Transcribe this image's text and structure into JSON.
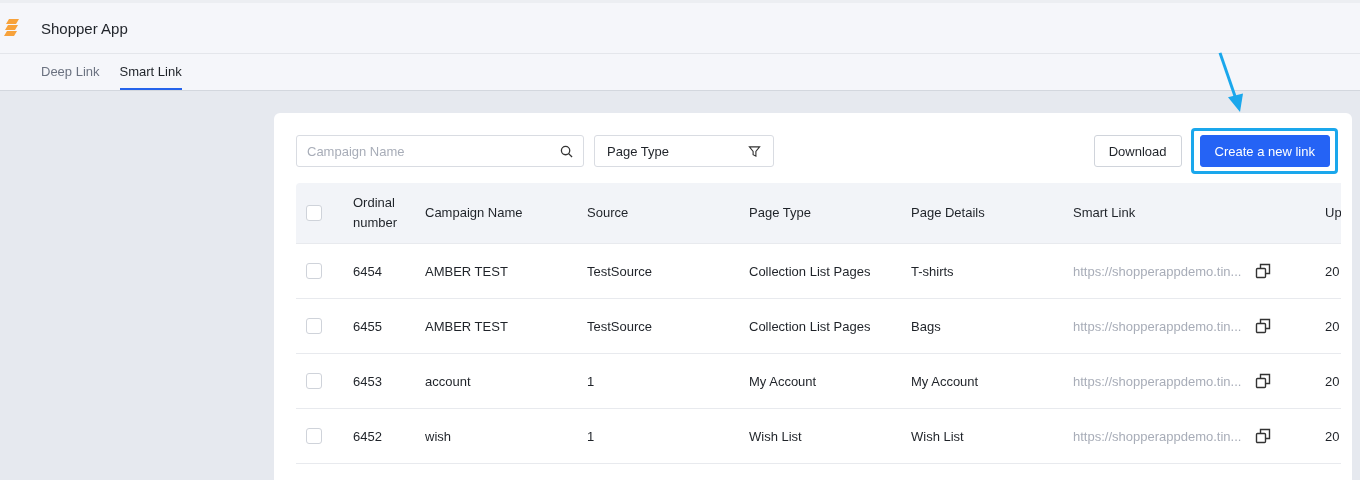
{
  "app": {
    "title": "Shopper App"
  },
  "tabs": [
    {
      "label": "Deep Link",
      "selected": false
    },
    {
      "label": "Smart Link",
      "selected": true
    }
  ],
  "filters": {
    "campaign_search": {
      "placeholder": "Campaign Name"
    },
    "page_type": {
      "value": "Page Type"
    }
  },
  "actions": {
    "download": "Download",
    "create": "Create a new link"
  },
  "table": {
    "header_checked": false,
    "columns": [
      "Ordinal\nnumber",
      "Campaign Name",
      "Source",
      "Page Type",
      "Page Details",
      "Smart Link",
      "Up"
    ],
    "rows": [
      {
        "checked": false,
        "cells": [
          "6454",
          "AMBER TEST",
          "TestSource",
          "Collection List Pages",
          "T-shirts",
          "https://shopperappdemo.tin...",
          "20"
        ]
      },
      {
        "checked": false,
        "cells": [
          "6455",
          "AMBER TEST",
          "TestSource",
          "Collection List Pages",
          "Bags",
          "https://shopperappdemo.tin...",
          "20"
        ]
      },
      {
        "checked": false,
        "cells": [
          "6453",
          "account",
          "1",
          "My Account",
          "My Account",
          "https://shopperappdemo.tin...",
          "20"
        ]
      },
      {
        "checked": false,
        "cells": [
          "6452",
          "wish",
          "1",
          "Wish List",
          "Wish List",
          "https://shopperappdemo.tin...",
          "20"
        ]
      }
    ]
  }
}
